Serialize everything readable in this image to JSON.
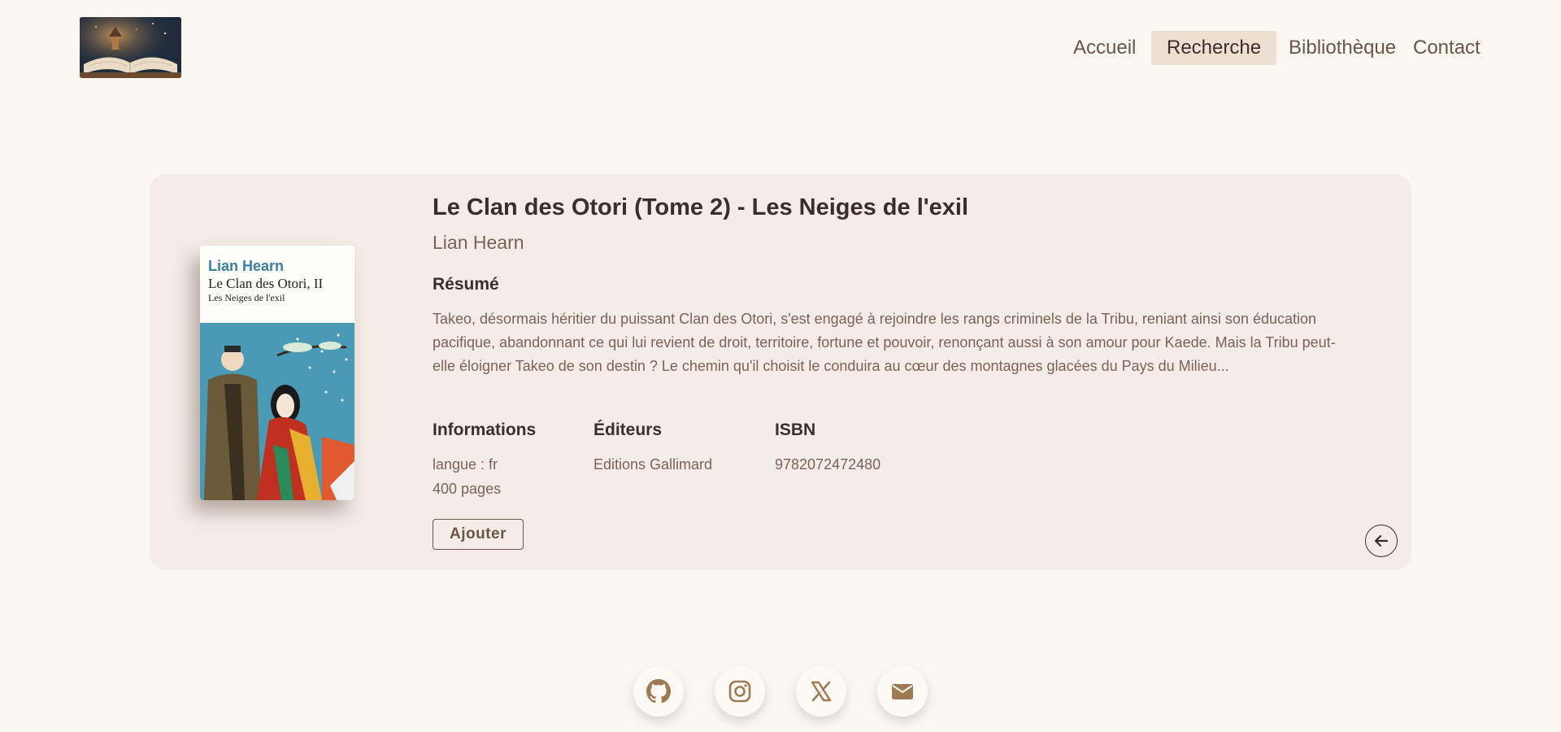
{
  "nav": {
    "items": [
      {
        "label": "Accueil"
      },
      {
        "label": "Recherche"
      },
      {
        "label": "Bibliothèque"
      },
      {
        "label": "Contact"
      }
    ],
    "active": "Recherche"
  },
  "book": {
    "title": "Le Clan des Otori (Tome 2) - Les Neiges de l'exil",
    "author": "Lian Hearn",
    "cover": {
      "author": "Lian Hearn",
      "title": "Le Clan des Otori, II",
      "subtitle": "Les Neiges de l'exil"
    },
    "summary_heading": "Résumé",
    "summary": "Takeo, désormais héritier du puissant Clan des Otori, s'est engagé à rejoindre les rangs criminels de la Tribu, reniant ainsi son éducation pacifique, abandonnant ce qui lui revient de droit, territoire, fortune et pouvoir, renonçant aussi à son amour pour Kaede. Mais la Tribu peut-elle éloigner Takeo de son destin ? Le chemin qu'il choisit le conduira au cœur des montagnes glacées du Pays du Milieu...",
    "info_heading": "Informations",
    "language": "langue : fr",
    "pages": "400 pages",
    "publishers_heading": "Éditeurs",
    "publisher": "Editions Gallimard",
    "isbn_heading": "ISBN",
    "isbn": "9782072472480",
    "add_label": "Ajouter"
  },
  "footer": {
    "socials": [
      "github-icon",
      "instagram-icon",
      "x-icon",
      "mail-icon"
    ]
  },
  "colors": {
    "background": "#fbf7f3",
    "card": "#f4ede7",
    "nav_active": "#ecdfd2",
    "text_dark": "#3a2e2a",
    "text_muted": "#7a6258",
    "icon_accent": "#a07a52"
  }
}
